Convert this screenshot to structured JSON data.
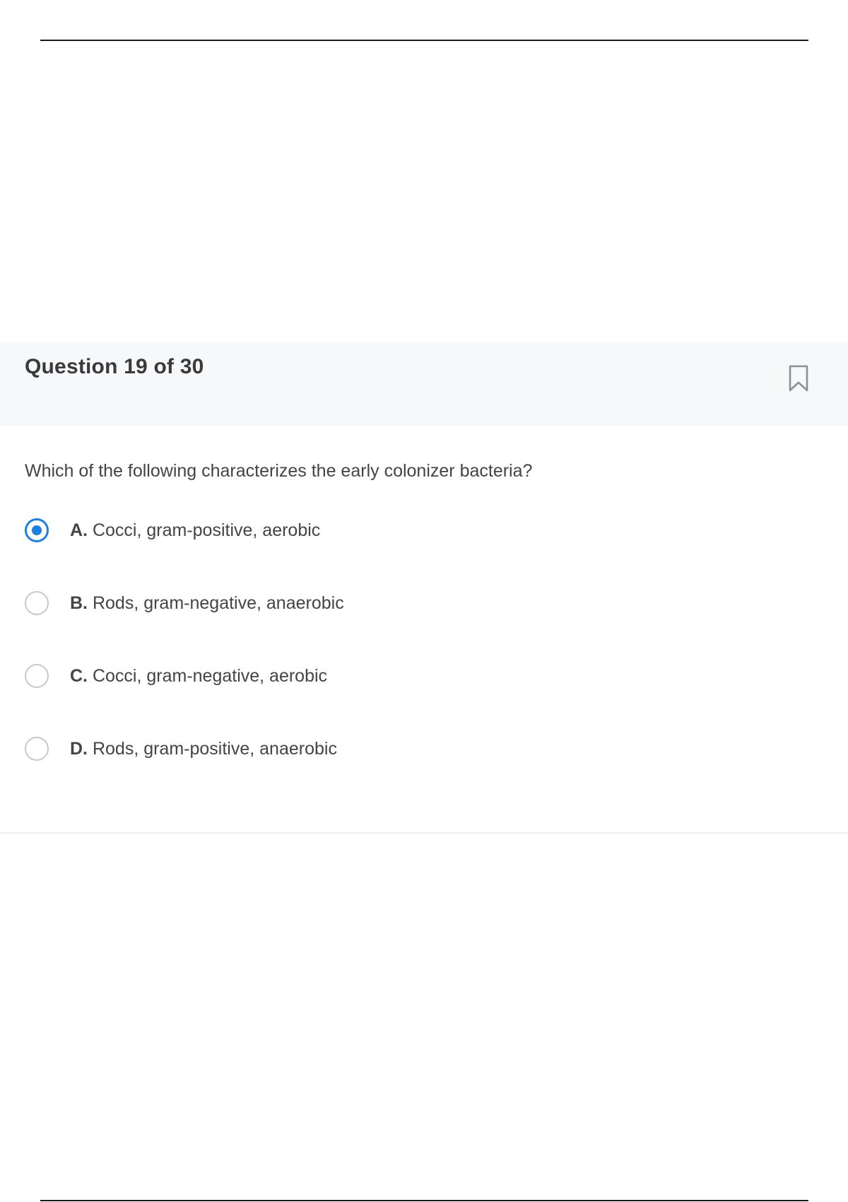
{
  "header": {
    "question_counter": "Question 19 of 30",
    "bookmark_icon": "bookmark-icon"
  },
  "question": {
    "text": "Which of the following characterizes the early colonizer bacteria?",
    "options": [
      {
        "letter": "A.",
        "text": "Cocci, gram-positive, aerobic",
        "selected": true
      },
      {
        "letter": "B.",
        "text": "Rods, gram-negative, anaerobic",
        "selected": false
      },
      {
        "letter": "C.",
        "text": "Cocci, gram-negative, aerobic",
        "selected": false
      },
      {
        "letter": "D.",
        "text": "Rods, gram-positive, anaerobic",
        "selected": false
      }
    ]
  },
  "colors": {
    "accent": "#1e7fe0",
    "header_bg": "#f7f8fa",
    "radio_border": "#c8c8c8",
    "text": "#444444"
  }
}
